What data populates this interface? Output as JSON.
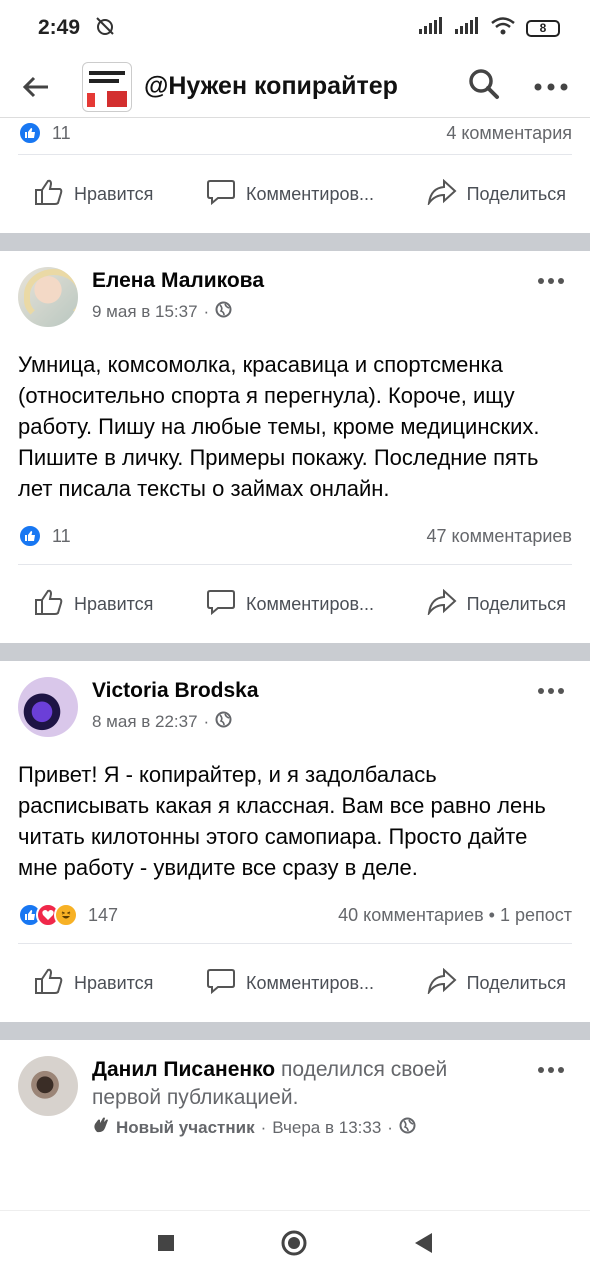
{
  "status_bar": {
    "time": "2:49",
    "battery": "8"
  },
  "header": {
    "title": "@Нужен копирайтер",
    "logo_text": "УИДЕЛИ"
  },
  "colors": {
    "accent": "#1877f2",
    "text": "#050505",
    "muted": "#65676b",
    "separator": "#c9ccd1"
  },
  "posts": [
    {
      "reactions_count": "11",
      "comments": "4 комментария",
      "actions": {
        "like": "Нравится",
        "comment": "Комментиров...",
        "share": "Поделиться"
      }
    },
    {
      "author": "Елена Маликова",
      "time": "9 мая в 15:37",
      "text": "Умница, комсомолка, красавица и спортсменка (относительно спорта я перегнула). Короче, ищу работу. Пишу на любые темы, кроме медицинских. Пишите в личку. Примеры покажу. Последние пять лет писала тексты о займах онлайн.",
      "reactions_count": "11",
      "comments": "47 комментариев",
      "actions": {
        "like": "Нравится",
        "comment": "Комментиров...",
        "share": "Поделиться"
      }
    },
    {
      "author": "Victoria Brodska",
      "time": "8 мая в 22:37",
      "text": "Привет! Я - копирайтер, и я задолбалась расписывать какая я классная. Вам все равно лень читать килотонны этого самопиара. Просто дайте мне работу -  увидите все сразу в деле.",
      "reactions_count": "147",
      "comments": "40 комментариев • 1 репост",
      "actions": {
        "like": "Нравится",
        "comment": "Комментиров...",
        "share": "Поделиться"
      }
    },
    {
      "author": "Данил Писаненко",
      "shared_text": "поделился своей первой публикацией.",
      "badge": "Новый участник",
      "time": "Вчера в 13:33"
    }
  ],
  "icons": [
    "back-arrow-icon",
    "search-icon",
    "more-icon",
    "like-icon",
    "comment-icon",
    "share-icon",
    "globe-icon",
    "wave-icon",
    "stop-icon",
    "home-icon",
    "back-icon"
  ]
}
